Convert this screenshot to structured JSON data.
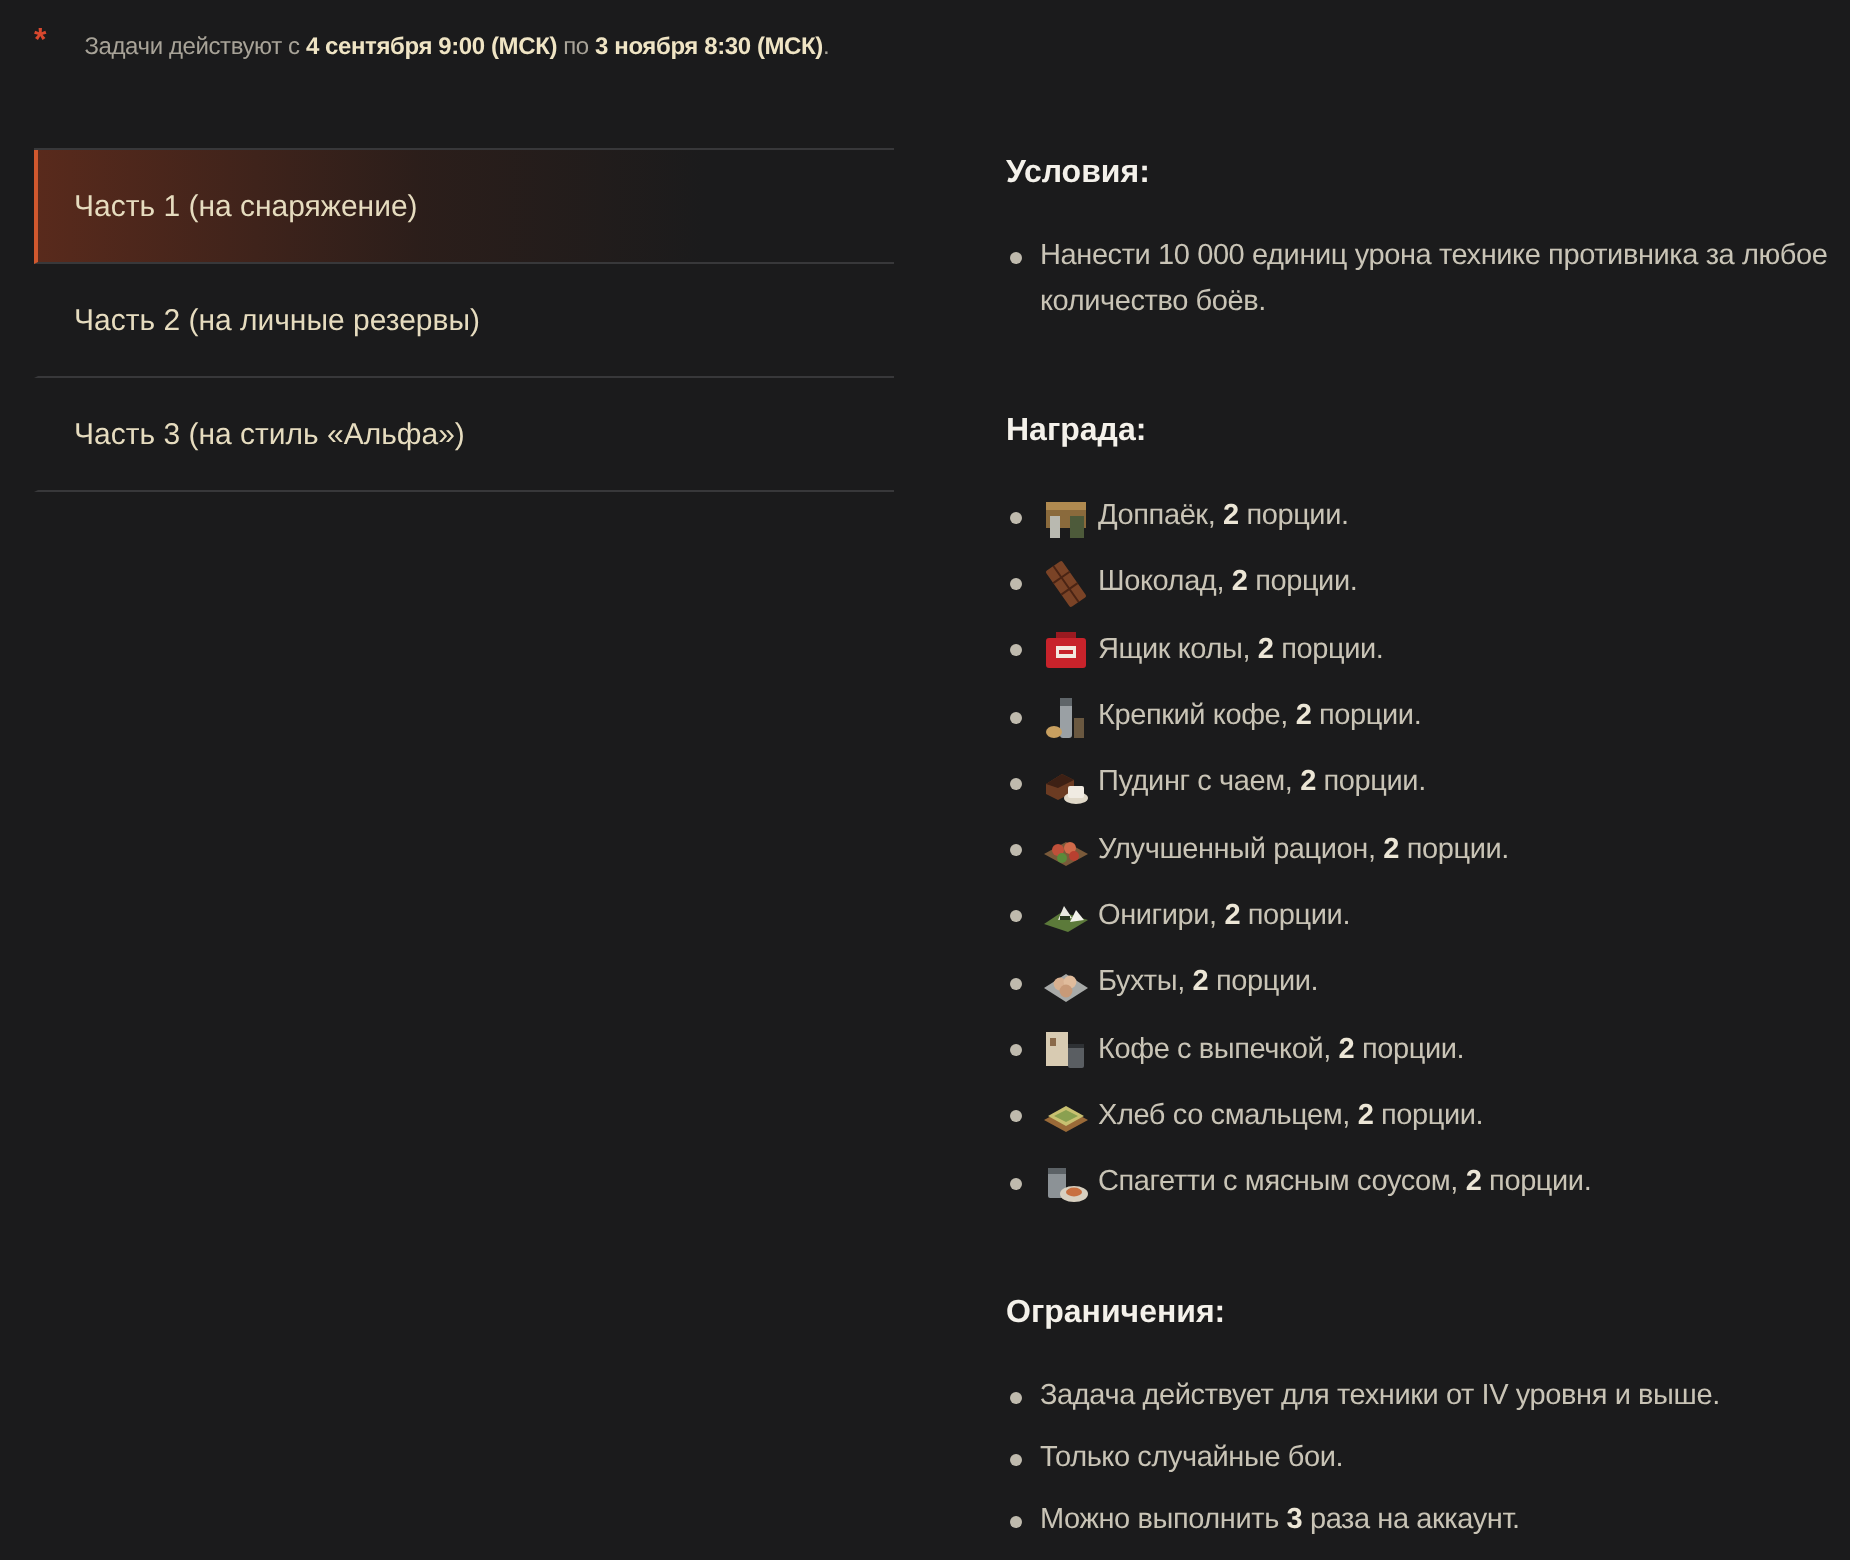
{
  "note": {
    "marker": "*",
    "text": "Задачи действуют с **4 сентября 9:00 (МСК)** по **3 ноября 8:30 (МСК)**."
  },
  "tabs": [
    {
      "label": "Часть 1 (на снаряжение)",
      "selected": true
    },
    {
      "label": "Часть 2 (на личные резервы)",
      "selected": false
    },
    {
      "label": "Часть 3 (на стиль «Альфа»)",
      "selected": false
    }
  ],
  "sections": [
    {
      "heading": "Условия:",
      "kind": "list",
      "items": [
        "Нанести 10 000 единиц урона технике противника за любое количество боёв."
      ]
    },
    {
      "heading": "Награда:",
      "kind": "rewards",
      "items": [
        "Доппаёк, **2** порции.",
        "Шоколад, **2** порции.",
        "Ящик колы, **2** порции.",
        "Крепкий кофе, **2** порции.",
        "Пудинг с чаем, **2** порции.",
        "Улучшенный рацион, **2** порции.",
        "Онигири, **2** порции.",
        "Бухты, **2** порции.",
        "Кофе с выпечкой, **2** порции.",
        "Хлеб со смальцем, **2** порции.",
        "Спагетти с мясным соусом, **2** порции."
      ]
    },
    {
      "heading": "Ограничения:",
      "kind": "list",
      "items": [
        "Задача действует для техники от IV уровня и выше.",
        "Только случайные бои.",
        "Можно выполнить **3** раза на аккаунт."
      ]
    }
  ]
}
